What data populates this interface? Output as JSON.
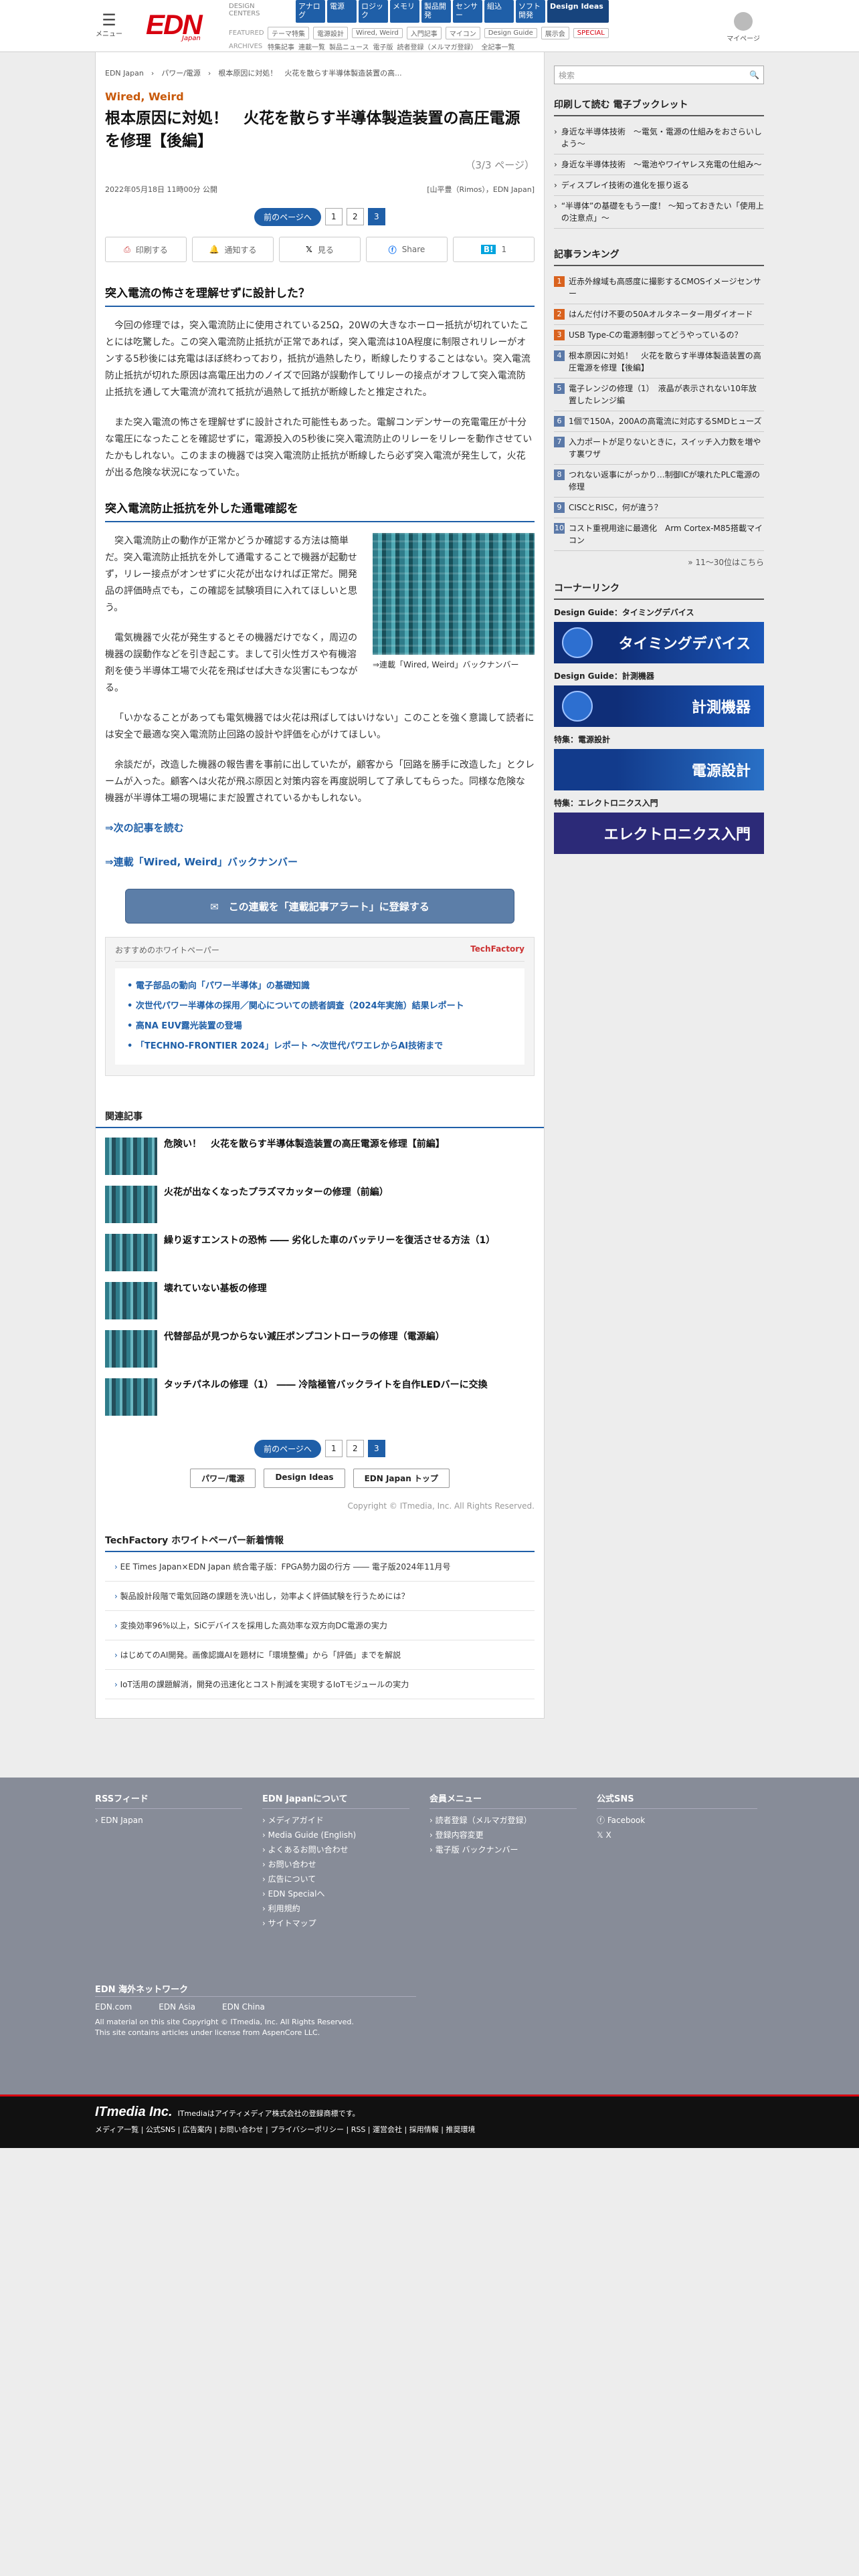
{
  "header": {
    "menu": "メニュー",
    "logo": "EDN",
    "logo_sub": "Japan",
    "dc_label": "DESIGN\nCENTERS",
    "cats": [
      "アナログ",
      "電源",
      "ロジック",
      "メモリ",
      "製品開発",
      "センサー",
      "組込",
      "ソフト開発"
    ],
    "design_ideas": "Design Ideas",
    "featured_label": "FEATURED",
    "featured": [
      "テーマ特集",
      "電源設計",
      "Wired, Weird",
      "入門記事",
      "マイコン",
      "Design Guide",
      "展示会",
      "SPECIAL"
    ],
    "archives_label": "ARCHIVES",
    "archives": [
      "特集記事",
      "連載一覧",
      "製品ニュース",
      "電子版",
      "読者登録（メルマガ登録）",
      "全記事一覧"
    ],
    "user": "マイページ"
  },
  "breadcrumb": "EDN Japan　›　パワー/電源　›　根本原因に対処！　火花を散らす半導体製造装置の高...",
  "article": {
    "kicker": "Wired, Weird",
    "title": "根本原因に対処！　火花を散らす半導体製造装置の高圧電源を修理【後編】",
    "page": "（3/3 ページ）",
    "date": "2022年05月18日 11時00分 公開",
    "author": "[山平豊（Rimos），EDN Japan]",
    "share": [
      "印刷する",
      "通知する",
      "見る",
      "Share",
      "1"
    ],
    "h1": "突入電流の怖さを理解せずに設計した？",
    "p1": "今回の修理では，突入電流防止に使用されている25Ω，20Wの大きなホーロー抵抗が切れていたことには吃驚した。この突入電流防止抵抗が正常であれば，突入電流は10A程度に制限されリレーがオンする5秒後には充電はほぼ終わっており，抵抗が過熱したり，断線したりすることはない。突入電流防止抵抗が切れた原因は高電圧出力のノイズで回路が誤動作してリレーの接点がオフして突入電流防止抵抗を通して大電流が流れて抵抗が過熱して抵抗が断線したと推定された。",
    "p2": "また突入電流の怖さを理解せずに設計された可能性もあった。電解コンデンサーの充電電圧が十分な電圧になったことを確認せずに，電源投入の5秒後に突入電流防止のリレーをリレーを動作させていたかもしれない。このままの機器では突入電流防止抵抗が断線したら必ず突入電流が発生して，火花が出る危険な状況になっていた。",
    "h2": "突入電流防止抵抗を外した通電確認を",
    "p3": "突入電流防止の動作が正常かどうか確認する方法は簡単だ。突入電流防止抵抗を外して通電することで機器が起動せず，リレー接点がオンせずに火花が出なければ正常だ。開発品の評価時点でも，この確認を試験項目に入れてほしいと思う。",
    "p4": "電気機器で火花が発生するとその機器だけでなく，周辺の機器の誤動作などを引き起こす。まして引火性ガスや有機溶剤を使う半導体工場で火花を飛ばせば大きな災害にもつながる。",
    "p5": "「いかなることがあっても電気機器では火花は飛ばしてはいけない」このことを強く意識して読者には安全で最適な突入電流防止回路の設計や評価を心がけてほしい。",
    "p6": "余談だが，改造した機器の報告書を事前に出していたが，顧客から「回路を勝手に改造した」とクレームが入った。顧客へは火花が飛ぶ原因と対策内容を再度説明して了承してもらった。同様な危険な機器が半導体工場の現場にまだ設置されているかもしれない。",
    "caption": "⇒連載「Wired, Weird」バックナンバー",
    "link1": "⇒次の記事を読む",
    "link2": "⇒連載「Wired, Weird」バックナンバー",
    "alert": "この連載を「連載記事アラート」に登録する"
  },
  "pager": {
    "prev": "前のページへ",
    "pages": [
      "1",
      "2",
      "3"
    ]
  },
  "whitepaper": {
    "title": "おすすめのホワイトペーパー",
    "brand": "TechFactory",
    "items": [
      "電子部品の動向「パワー半導体」の基礎知識",
      "次世代パワー半導体の採用／関心についての読者調査（2024年実施）結果レポート",
      "高NA EUV露光装置の登場",
      "「TECHNO-FRONTIER 2024」レポート 〜次世代パワエレからAI技術まで"
    ]
  },
  "related": {
    "title": "関連記事",
    "items": [
      "危険い！　火花を散らす半導体製造装置の高圧電源を修理【前編】",
      "火花が出なくなったプラズマカッターの修理（前編）",
      "繰り返すエンストの恐怖 ―― 劣化した車のバッテリーを復活させる方法（1）",
      "壊れていない基板の修理",
      "代替部品が見つからない減圧ポンプコントローラの修理（電源編）",
      "タッチパネルの修理（1） ―― 冷陰極管バックライトを自作LEDバーに交換"
    ]
  },
  "bottom_buttons": [
    "パワー/電源",
    "Design Ideas",
    "EDN Japan トップ"
  ],
  "copyright": "Copyright © ITmedia, Inc. All Rights Reserved.",
  "techfactory": {
    "title": "TechFactory ホワイトペーパー新着情報",
    "items": [
      "EE Times Japan×EDN Japan 統合電子版：FPGA勢力図の行方 ―― 電子版2024年11月号",
      "製品設計段階で電気回路の課題を洗い出し，効率よく評価試験を行うためには？",
      "変換効率96%以上，SiCデバイスを採用した高効率な双方向DC電源の実力",
      "はじめてのAI開発。画像認識AIを題材に「環境整備」から「評価」までを解説",
      "IoT活用の課題解消，開発の迅速化とコスト削減を実現するIoTモジュールの実力"
    ]
  },
  "sidebar": {
    "search_placeholder": "検索",
    "booklet_title": "印刷して読む 電子ブックレット",
    "booklets": [
      "身近な半導体技術　〜電気・電源の仕組みをおさらいしよう〜",
      "身近な半導体技術　〜電池やワイヤレス充電の仕組み〜",
      "ディスプレイ技術の進化を振り返る",
      "“半導体”の基礎をもう一度！ 〜知っておきたい「使用上の注意点」〜"
    ],
    "ranking_title": "記事ランキング",
    "ranking": [
      "近赤外線域も高感度に撮影するCMOSイメージセンサー",
      "はんだ付け不要の50Aオルタネーター用ダイオード",
      "USB Type-Cの電源制御ってどうやっているの？",
      "根本原因に対処！　火花を散らす半導体製造装置の高圧電源を修理【後編】",
      "電子レンジの修理（1）　液晶が表示されない10年放置したレンジ編",
      "1個で150A，200Aの高電流に対応するSMDヒューズ",
      "入力ポートが足りないときに，スイッチ入力数を増やす裏ワザ",
      "つれない返事にがっかり…制御ICが壊れたPLC電源の修理",
      "CISCとRISC，何が違う？",
      "コスト重視用途に最適化　Arm Cortex-M85搭載マイコン"
    ],
    "ranking_more": "» 11〜30位はこちら",
    "corner_title": "コーナーリンク",
    "corners": [
      {
        "label": "Design Guide：タイミングデバイス",
        "banner": "タイミングデバイス"
      },
      {
        "label": "Design Guide：計測機器",
        "banner": "計測機器"
      },
      {
        "label": "特集：電源設計",
        "banner": "電源設計"
      },
      {
        "label": "特集：エレクトロニクス入門",
        "banner": "エレクトロニクス入門"
      }
    ]
  },
  "footer": {
    "rss_title": "RSSフィード",
    "rss": [
      "EDN Japan"
    ],
    "about_title": "EDN Japanについて",
    "about": [
      "メディアガイド",
      "Media Guide (English)",
      "よくあるお問い合わせ",
      "お問い合わせ",
      "広告について",
      "EDN Specialへ",
      "利用規約",
      "サイトマップ"
    ],
    "member_title": "会員メニュー",
    "member": [
      "読者登録（メルマガ登録）",
      "登録内容変更",
      "電子版 バックナンバー"
    ],
    "sns_title": "公式SNS",
    "sns": [
      "Facebook",
      "X"
    ],
    "net_title": "EDN 海外ネットワーク",
    "net": [
      "EDN.com",
      "EDN Asia",
      "EDN China"
    ],
    "copy1": "All material on this site Copyright © ITmedia, Inc. All Rights Reserved.",
    "copy2": "This site contains articles under license from AspenCore LLC."
  },
  "itmedia": {
    "logo": "ITmedia Inc.",
    "note": "ITmediaはアイティメディア株式会社の登録商標です。",
    "links": "メディア一覧 | 公式SNS | 広告案内 | お問い合わせ | プライバシーポリシー | RSS | 運営会社 | 採用情報 | 推奨環境"
  }
}
